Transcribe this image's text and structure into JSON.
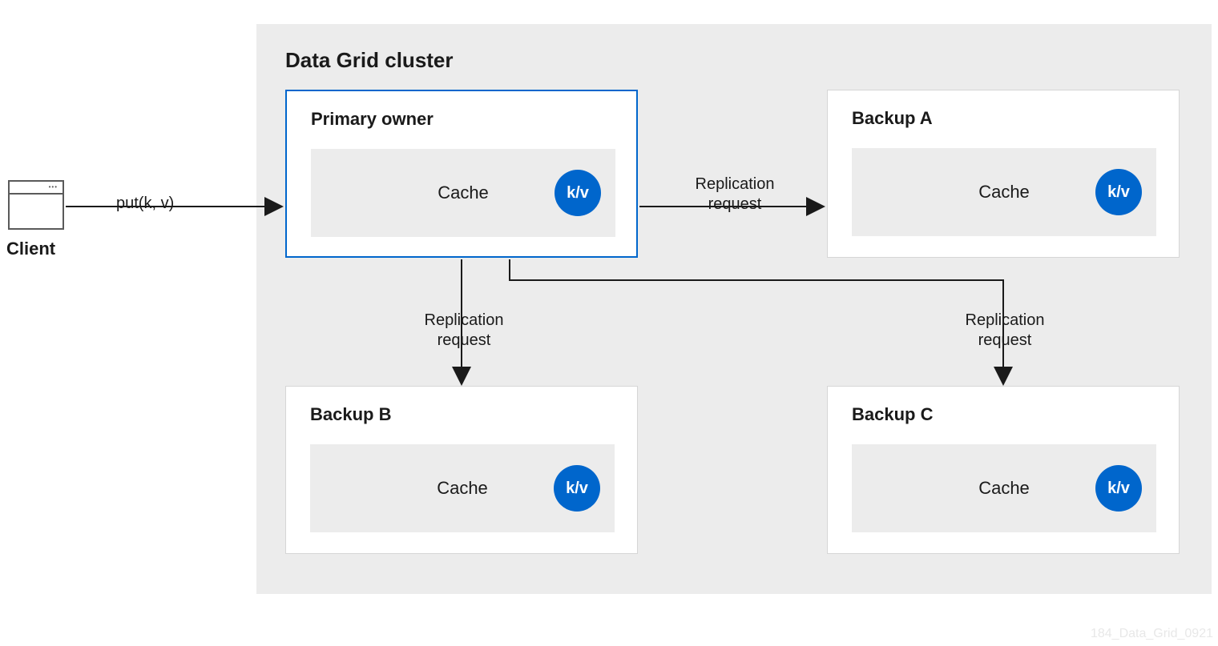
{
  "client": {
    "label": "Client"
  },
  "cluster": {
    "title": "Data Grid cluster"
  },
  "nodes": {
    "primary": {
      "title": "Primary owner",
      "cache": "Cache",
      "kv": "k/v"
    },
    "backupA": {
      "title": "Backup A",
      "cache": "Cache",
      "kv": "k/v"
    },
    "backupB": {
      "title": "Backup B",
      "cache": "Cache",
      "kv": "k/v"
    },
    "backupC": {
      "title": "Backup C",
      "cache": "Cache",
      "kv": "k/v"
    }
  },
  "edges": {
    "clientToPrimary": "put(k, v)",
    "primaryToA": "Replication request",
    "primaryToB": "Replication request",
    "primaryToC": "Replication request"
  },
  "footer": "184_Data_Grid_0921"
}
